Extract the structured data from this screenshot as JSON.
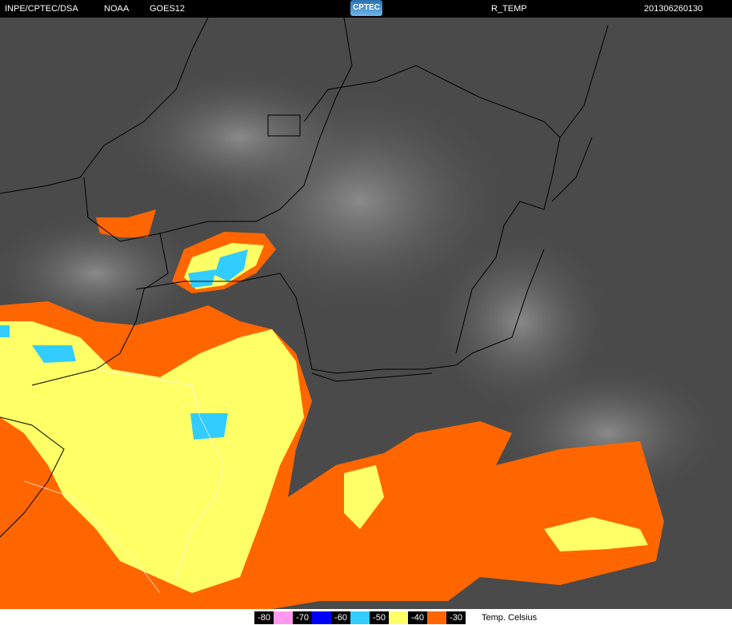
{
  "header": {
    "institution": "INPE/CPTEC/DSA",
    "agency": "NOAA",
    "satellite": "GOES12",
    "logo_text": "CPTEC",
    "product": "R_TEMP",
    "timestamp": "201306260130"
  },
  "legend": {
    "items": [
      {
        "label": "-80",
        "color": "#ff99ee"
      },
      {
        "label": "-70",
        "color": "#0000ff"
      },
      {
        "label": "-60",
        "color": "#33ccff"
      },
      {
        "label": "-50",
        "color": "#ffff66"
      },
      {
        "label": "-40",
        "color": "#ff6600"
      },
      {
        "label": "-30",
        "color": null
      }
    ],
    "unit": "Temp. Celsius"
  }
}
